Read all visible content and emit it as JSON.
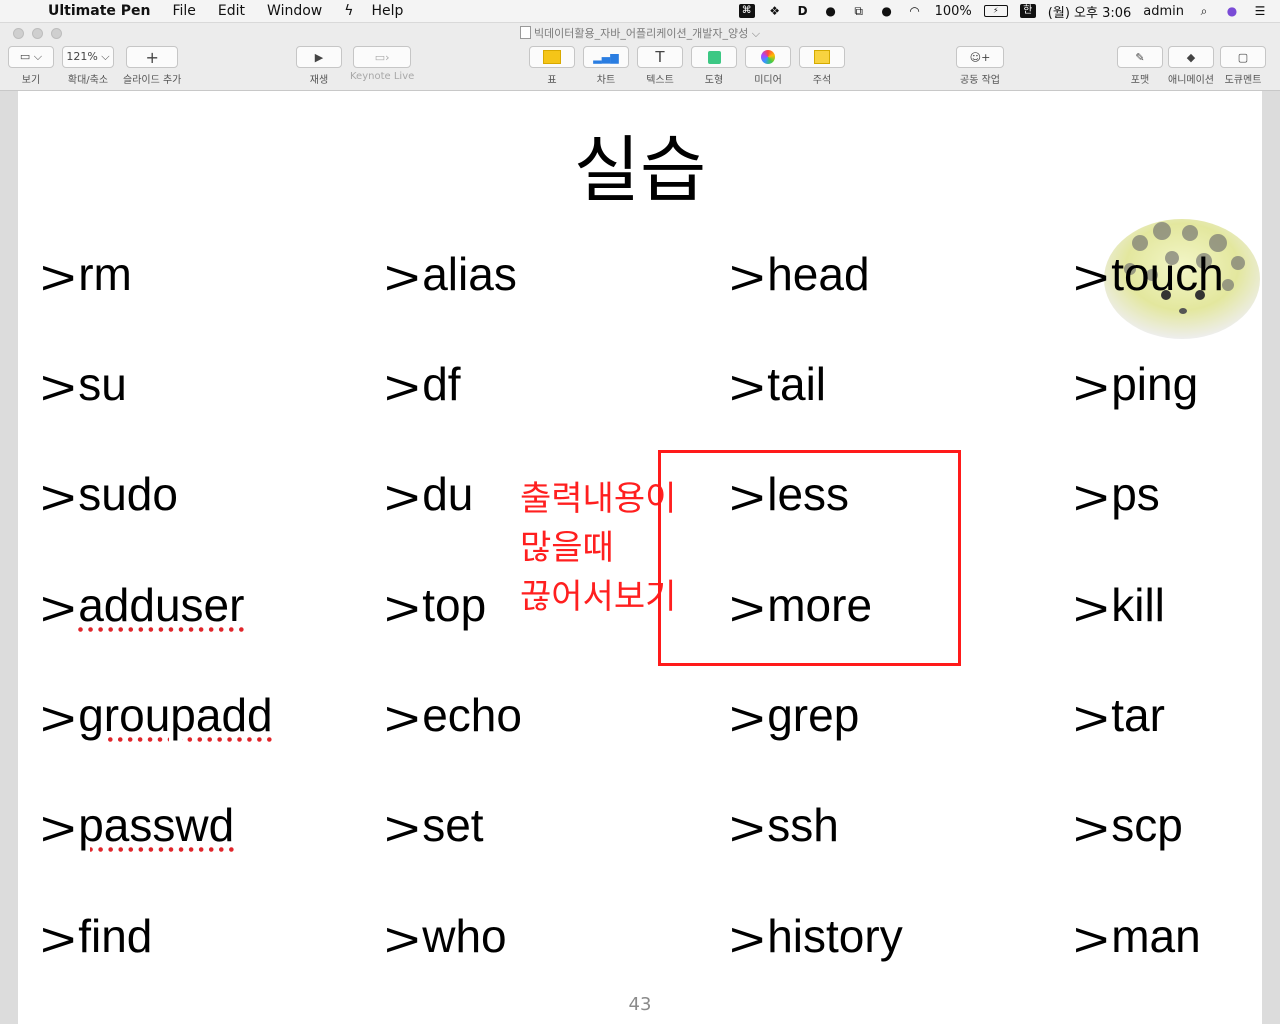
{
  "menubar": {
    "app_name": "Ultimate Pen",
    "items": [
      "File",
      "Edit",
      "Window",
      "Help"
    ],
    "battery": "100%",
    "input_method": "한",
    "clock": "(월) 오후 3:06",
    "user": "admin"
  },
  "window": {
    "doc_title": "빅데이터활용_자바_어플리케이션_개발자_양성 ⌵"
  },
  "toolbar": {
    "view_label": "보기",
    "zoom_value": "121% ⌵",
    "zoom_label": "확대/축소",
    "add_slide_label": "슬라이드 추가",
    "play_label": "재생",
    "keynote_live_label": "Keynote Live",
    "table_label": "표",
    "chart_label": "차트",
    "text_label": "텍스트",
    "shape_label": "도형",
    "media_label": "미디어",
    "comment_label": "주석",
    "collab_label": "공동 작업",
    "format_label": "포맷",
    "animate_label": "애니메이션",
    "document_label": "도큐멘트"
  },
  "slide": {
    "title": "실습",
    "prompt_symbol": ">",
    "columns": [
      [
        "rm",
        "su",
        "sudo",
        "adduser",
        "groupadd",
        "passwd",
        "find"
      ],
      [
        "alias",
        "df",
        "du",
        "top",
        "echo",
        "set",
        "who"
      ],
      [
        "head",
        "tail",
        "less",
        "more",
        "grep",
        "ssh",
        "history"
      ],
      [
        "touch",
        "ping",
        "ps",
        "kill",
        "tar",
        "scp",
        "man"
      ]
    ],
    "annotation_lines": [
      "출력내용이",
      "많을때",
      "끊어서보기"
    ],
    "page_number": "43"
  },
  "colors": {
    "annotation": "#ff1f1f",
    "highlight_box": "#ff1a1a",
    "spellcheck": "#e0262b"
  }
}
